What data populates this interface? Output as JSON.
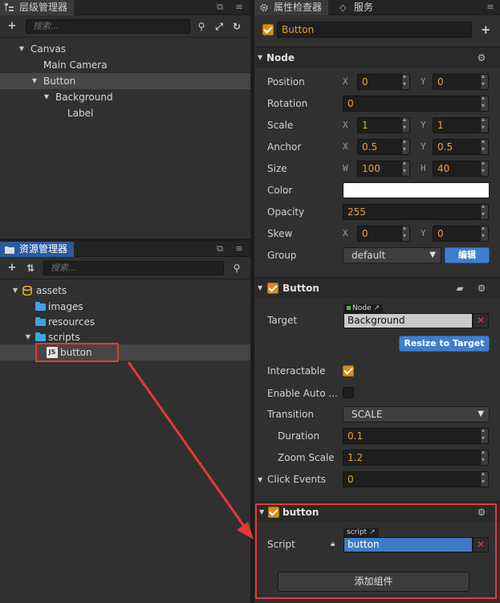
{
  "hierarchy": {
    "tab_label": "层级管理器",
    "search_placeholder": "搜索...",
    "items": [
      {
        "label": "Canvas"
      },
      {
        "label": "Main Camera"
      },
      {
        "label": "Button"
      },
      {
        "label": "Background"
      },
      {
        "label": "Label"
      }
    ]
  },
  "assets": {
    "tab_label": "资源管理器",
    "search_placeholder": "搜索...",
    "items": [
      {
        "label": "assets"
      },
      {
        "label": "images"
      },
      {
        "label": "resources"
      },
      {
        "label": "scripts"
      },
      {
        "label": "button"
      }
    ]
  },
  "inspector": {
    "tab_label": "属性检查器",
    "service_tab_label": "服务",
    "node_name": "Button",
    "node_section": {
      "title": "Node",
      "position": {
        "label": "Position",
        "x": "0",
        "y": "0"
      },
      "rotation": {
        "label": "Rotation",
        "value": "0"
      },
      "scale": {
        "label": "Scale",
        "x": "1",
        "y": "1"
      },
      "anchor": {
        "label": "Anchor",
        "x": "0.5",
        "y": "0.5"
      },
      "size": {
        "label": "Size",
        "w": "100",
        "h": "40"
      },
      "color": {
        "label": "Color",
        "value": "#ffffff"
      },
      "opacity": {
        "label": "Opacity",
        "value": "255"
      },
      "skew": {
        "label": "Skew",
        "x": "0",
        "y": "0"
      },
      "group": {
        "label": "Group",
        "value": "default",
        "edit_label": "编辑"
      },
      "axis_x": "X",
      "axis_y": "Y",
      "axis_w": "W",
      "axis_h": "H"
    },
    "button_section": {
      "title": "Button",
      "target": {
        "label": "Target",
        "tag": "Node",
        "value": "Background"
      },
      "resize_label": "Resize to Target",
      "interactable": {
        "label": "Interactable",
        "checked": true
      },
      "enable_auto": {
        "label": "Enable Auto ...",
        "checked": false
      },
      "transition": {
        "label": "Transition",
        "value": "SCALE"
      },
      "duration": {
        "label": "Duration",
        "value": "0.1"
      },
      "zoom_scale": {
        "label": "Zoom Scale",
        "value": "1.2"
      },
      "click_events": {
        "label": "Click Events",
        "value": "0"
      }
    },
    "script_section": {
      "title": "button",
      "script": {
        "label": "Script",
        "tag": "script",
        "value": "button"
      },
      "add_component_label": "添加组件"
    }
  },
  "colors": {
    "accent_orange": "#d98c1e",
    "highlight_red": "#e53935",
    "button_blue": "#3f7fca",
    "folder_blue": "#3fa2e6"
  }
}
